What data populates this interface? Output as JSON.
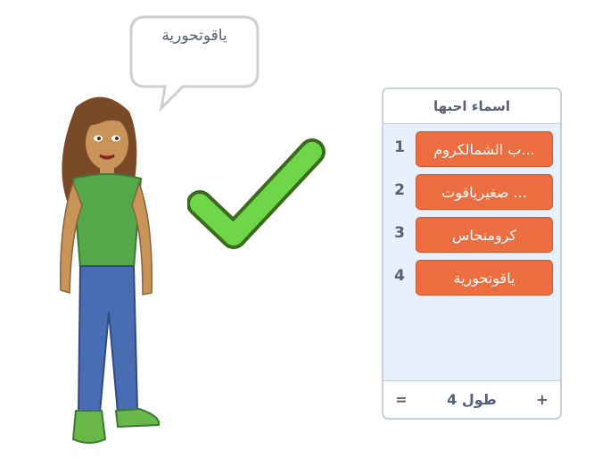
{
  "speech_bubble": {
    "text": "ياقوتحورية"
  },
  "list_monitor": {
    "title": "اسماء احبها",
    "items": [
      {
        "index": "1",
        "value": "...ب الشمالكروم"
      },
      {
        "index": "2",
        "value": "... صغيرياقوت"
      },
      {
        "index": "3",
        "value": "كرومنحاس"
      },
      {
        "index": "4",
        "value": "ياقوتحورية"
      }
    ],
    "add_label": "+",
    "length_label": "طول 4",
    "resize_label": "="
  },
  "colors": {
    "list_item": "#ec6e40",
    "monitor_bg": "#e6f0ff",
    "check_green": "#6fd64a",
    "text": "#575e75"
  },
  "icons": {
    "check": "checkmark-icon",
    "character": "girl-sprite"
  }
}
